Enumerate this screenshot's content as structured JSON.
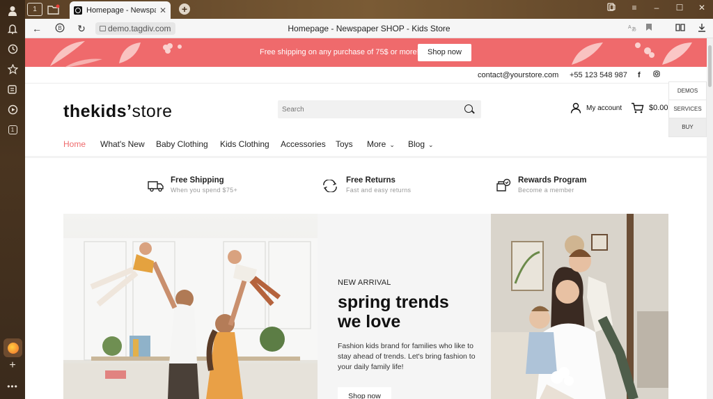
{
  "browser": {
    "tab_title": "Homepage - Newspaper",
    "tab_counter": "1",
    "side_counter": "1",
    "url": "demo.tagdiv.com",
    "page_title": "Homepage - Newspaper SHOP - Kids Store"
  },
  "promo": {
    "text": "Free shipping on any purchase of 75$ or more!",
    "button": "Shop now"
  },
  "topbar": {
    "email": "contact@yourstore.com",
    "phone": "+55 123 548 987"
  },
  "header": {
    "logo_bold": "thekids’",
    "logo_light": "store",
    "search_placeholder": "Search",
    "account": "My account",
    "cart_total": "$0.00"
  },
  "menu": {
    "items": [
      "Home",
      "What's New",
      "Baby Clothing",
      "Kids Clothing",
      "Accessories",
      "Toys",
      "More",
      "Blog"
    ]
  },
  "side_widget": [
    "DEMOS",
    "SERVICES",
    "BUY"
  ],
  "features": [
    {
      "title": "Free Shipping",
      "subtitle": "When you spend $75+"
    },
    {
      "title": "Free Returns",
      "subtitle": "Fast and easy returns"
    },
    {
      "title": "Rewards Program",
      "subtitle": "Become a member"
    }
  ],
  "hero": {
    "eyebrow": "NEW ARRIVAL",
    "title_line1": "spring trends",
    "title_line2": "we love",
    "description": "Fashion kids brand for families who like to stay ahead of trends. Let's bring fashion to your daily family life!",
    "button": "Shop now"
  },
  "colors": {
    "accent": "#ef6a6c"
  }
}
